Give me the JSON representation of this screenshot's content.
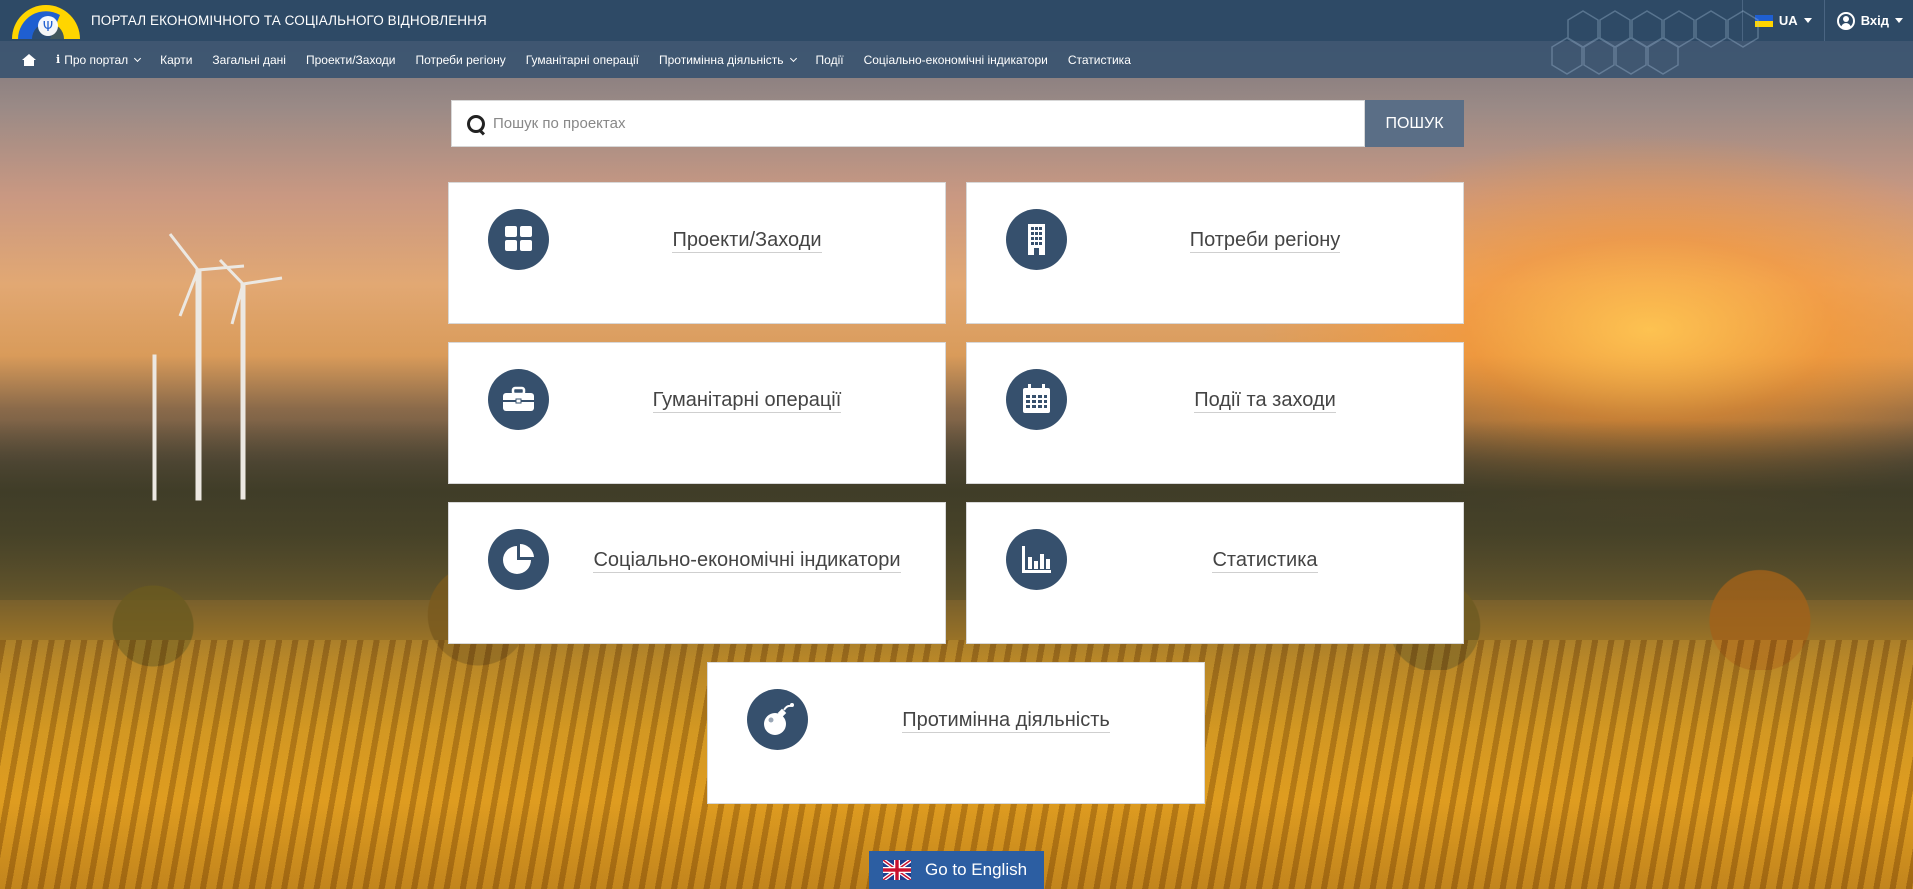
{
  "header": {
    "title": "ПОРТАЛ ЕКОНОМІЧНОГО ТА СОЦІАЛЬНОГО ВІДНОВЛЕННЯ",
    "language": "UA",
    "login": "Вхід"
  },
  "nav": {
    "items": [
      {
        "label": "Про портал"
      },
      {
        "label": "Карти"
      },
      {
        "label": "Загальні дані"
      },
      {
        "label": "Проекти/Заходи"
      },
      {
        "label": "Потреби регіону"
      },
      {
        "label": "Гуманітарні операції"
      },
      {
        "label": "Протимінна діяльність"
      },
      {
        "label": "Події"
      },
      {
        "label": "Соціально-економічні індикатори"
      },
      {
        "label": "Статистика"
      }
    ]
  },
  "search": {
    "placeholder": "Пошук по проектах",
    "value": "",
    "button": "ПОШУК"
  },
  "tiles": [
    {
      "label": "Проекти/Заходи",
      "icon": "grid-icon"
    },
    {
      "label": "Потреби регіону",
      "icon": "building-icon"
    },
    {
      "label": "Гуманітарні операції",
      "icon": "briefcase-icon"
    },
    {
      "label": "Події та заходи",
      "icon": "calendar-icon"
    },
    {
      "label": "Соціально-економічні індикатори",
      "icon": "pie-chart-icon"
    },
    {
      "label": "Статистика",
      "icon": "bar-chart-icon"
    },
    {
      "label": "Протимінна діяльність",
      "icon": "bomb-icon"
    }
  ],
  "footer": {
    "go_english": "Go to English"
  },
  "colors": {
    "topbar": "#2e4a66",
    "navbar": "#3a5470",
    "tile_icon_bg": "#36506d",
    "search_button": "#5a6e86",
    "english_button": "#2c5ea2"
  }
}
